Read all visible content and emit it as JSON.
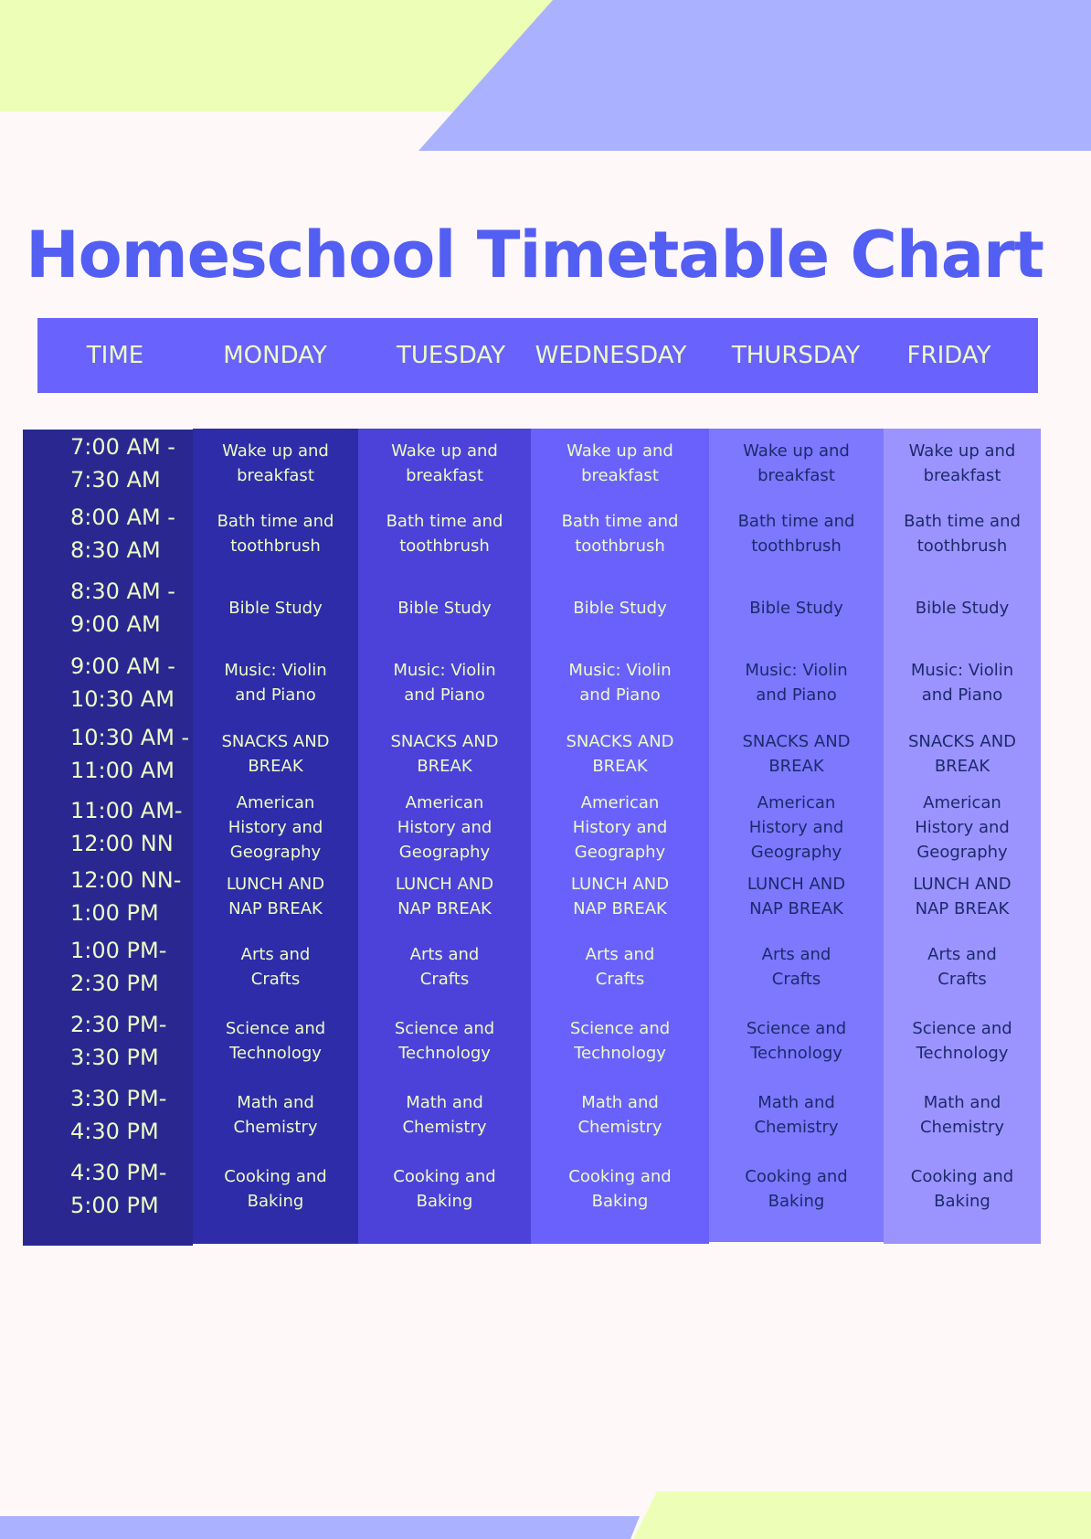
{
  "title": "Homeschool Timetable Chart",
  "colors": {
    "background": "#fef8f8",
    "accent_green": "#edfeb6",
    "accent_blue": "#aab1fe",
    "title": "#535ef3",
    "header_bar": "#6a62fd",
    "time_column": "#2a2890",
    "monday": "#2e2ca8",
    "tuesday": "#4c42d9",
    "wednesday": "#6a61fd",
    "thursday": "#7d78fe",
    "friday": "#9c94fe",
    "light_text": "#edfbc6",
    "dark_text": "#1c2a6b"
  },
  "headers": [
    "TIME",
    "MONDAY",
    "TUESDAY",
    "WEDNESDAY",
    "THURSDAY",
    "FRIDAY"
  ],
  "times": [
    "7:00 AM - 7:30 AM",
    "8:00 AM - 8:30 AM",
    "8:30 AM - 9:00 AM",
    "9:00 AM - 10:30 AM",
    "10:30 AM - 11:00 AM",
    "11:00 AM- 12:00 NN",
    "12:00 NN- 1:00 PM",
    "1:00 PM- 2:30 PM",
    "2:30 PM- 3:30 PM",
    "3:30 PM- 4:30 PM",
    "4:30 PM- 5:00 PM"
  ],
  "times_lines": [
    [
      "7:00 AM -",
      "7:30 AM"
    ],
    [
      "8:00 AM -",
      "8:30 AM"
    ],
    [
      "8:30 AM -",
      "9:00 AM"
    ],
    [
      "9:00 AM -",
      "10:30 AM"
    ],
    [
      "10:30 AM -",
      "11:00 AM"
    ],
    [
      "11:00 AM-",
      "12:00 NN"
    ],
    [
      "12:00 NN-",
      "1:00 PM"
    ],
    [
      "1:00 PM-",
      "2:30 PM"
    ],
    [
      "2:30 PM-",
      "3:30 PM"
    ],
    [
      "3:30 PM-",
      "4:30 PM"
    ],
    [
      "4:30 PM-",
      "5:00 PM"
    ]
  ],
  "activities": [
    "Wake up and breakfast",
    "Bath time and toothbrush",
    "Bible Study",
    "Music: Violin and Piano",
    "SNACKS AND BREAK",
    "American History and Geography",
    "LUNCH AND NAP BREAK",
    "Arts and Crafts",
    "Science and Technology",
    "Math and Chemistry",
    "Cooking and Baking"
  ],
  "schedule": {
    "monday": [
      "Wake up and breakfast",
      "Bath time and toothbrush",
      "Bible Study",
      "Music: Violin and Piano",
      "SNACKS AND BREAK",
      "American History and Geography",
      "LUNCH AND NAP BREAK",
      "Arts and Crafts",
      "Science and Technology",
      "Math and Chemistry",
      "Cooking and Baking"
    ],
    "tuesday": [
      "Wake up and breakfast",
      "Bath time and toothbrush",
      "Bible Study",
      "Music: Violin and Piano",
      "SNACKS AND BREAK",
      "American History and Geography",
      "LUNCH AND NAP BREAK",
      "Arts and Crafts",
      "Science and Technology",
      "Math and Chemistry",
      "Cooking and Baking"
    ],
    "wednesday": [
      "Wake up and breakfast",
      "Bath time and toothbrush",
      "Bible Study",
      "Music: Violin and Piano",
      "SNACKS AND BREAK",
      "American History and Geography",
      "LUNCH AND NAP BREAK",
      "Arts and Crafts",
      "Science and Technology",
      "Math and Chemistry",
      "Cooking and Baking"
    ],
    "thursday": [
      "Wake up and breakfast",
      "Bath time and toothbrush",
      "Bible Study",
      "Music: Violin and Piano",
      "SNACKS AND BREAK",
      "American History and Geography",
      "LUNCH AND NAP BREAK",
      "Arts and Crafts",
      "Science and Technology",
      "Math and Chemistry",
      "Cooking and Baking"
    ],
    "friday": [
      "Wake up and breakfast",
      "Bath time and toothbrush",
      "Bible Study",
      "Music: Violin and Piano",
      "SNACKS AND BREAK",
      "American History and Geography",
      "LUNCH AND NAP BREAK",
      "Arts and Crafts",
      "Science and Technology",
      "Math and Chemistry",
      "Cooking and Baking"
    ]
  }
}
